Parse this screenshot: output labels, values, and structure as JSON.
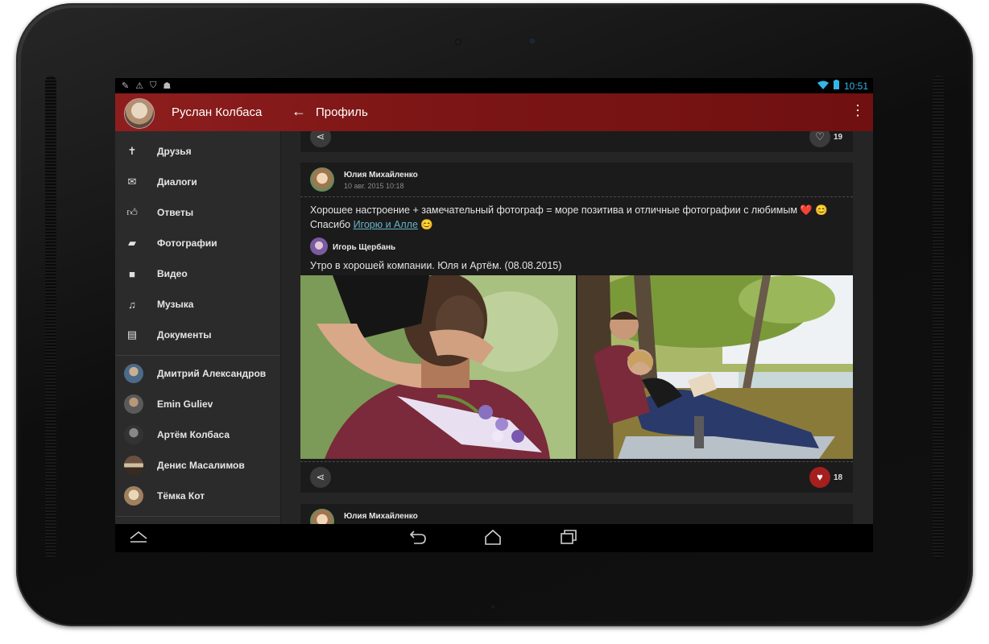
{
  "status_bar": {
    "time": "10:51"
  },
  "app_bar": {
    "user_name": "Руслан Колбаса",
    "screen_title": "Профиль"
  },
  "sidebar": {
    "menu": [
      {
        "label": "Друзья",
        "icon": "person-icon"
      },
      {
        "label": "Диалоги",
        "icon": "mail-icon"
      },
      {
        "label": "Ответы",
        "icon": "thumb-up-icon"
      },
      {
        "label": "Фотографии",
        "icon": "photos-icon"
      },
      {
        "label": "Видео",
        "icon": "video-icon"
      },
      {
        "label": "Музыка",
        "icon": "headphones-icon"
      },
      {
        "label": "Документы",
        "icon": "document-icon"
      }
    ],
    "friends": [
      {
        "name": "Дмитрий Александров"
      },
      {
        "name": "Emin Guliev"
      },
      {
        "name": "Артём Колбаса"
      },
      {
        "name": "Денис Масалимов"
      },
      {
        "name": "Тёмка Кот"
      }
    ]
  },
  "feed": {
    "prev_card": {
      "likes": "19"
    },
    "post": {
      "author": "Юлия Михайленко",
      "date": "10 авг. 2015 10:18",
      "text_line1": "Хорошее настроение + замечательный фотограф = море позитива и отличные фотографии с любимым ❤️ 😊",
      "text_line2_prefix": "Спасибо ",
      "text_line2_link": "Игорю и Алле",
      "text_line2_suffix": " 😊",
      "repost_author": "Игорь Щербань",
      "repost_text": "Утро в хорошей компании. Юля и Артём. (08.08.2015)",
      "likes": "18",
      "liked": true
    },
    "next_card": {
      "author": "Юлия Михайленко"
    }
  },
  "colors": {
    "app_bar": "#7d1616",
    "accent_link": "#66b4c8",
    "like_active": "#a51f1f",
    "status_icons": "#33b5e5"
  }
}
